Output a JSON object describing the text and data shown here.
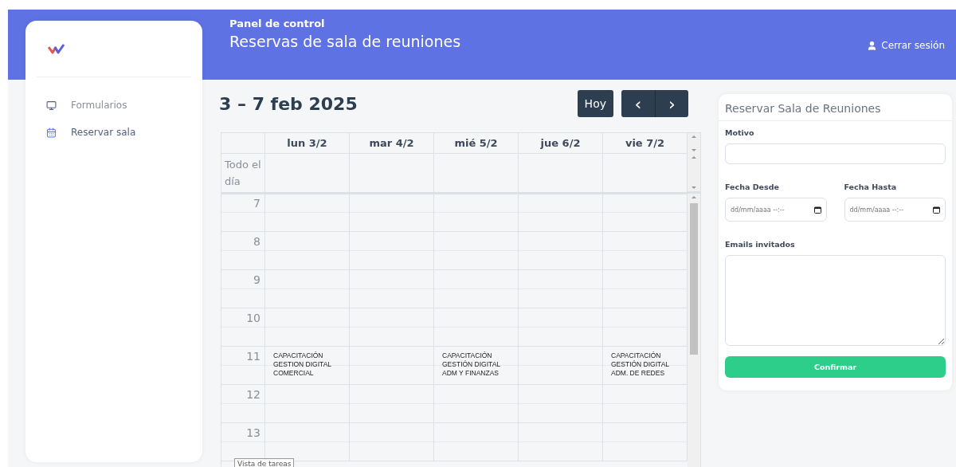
{
  "header": {
    "subtitle": "Panel de control",
    "title": "Reservas de sala de reuniones",
    "logout": "Cerrar sesión"
  },
  "sidebar": {
    "items": [
      {
        "label": "Formularios",
        "selected": false
      },
      {
        "label": "Reservar sala",
        "selected": true
      }
    ]
  },
  "calendar": {
    "range": "3 – 7 feb 2025",
    "today_button": "Hoy",
    "prev_button": "‹",
    "next_button": "›",
    "all_day_label": "Todo el día",
    "days": [
      "lun 3/2",
      "mar 4/2",
      "mié 5/2",
      "jue 6/2",
      "vie 7/2"
    ],
    "rows": [
      {
        "hour": "7"
      },
      {
        "hour": "8"
      },
      {
        "hour": "9"
      },
      {
        "hour": "10"
      },
      {
        "hour": "11",
        "cells": [
          "CAPACITACIÓN\nGESTION DIGITAL\nCOMERCIAL",
          null,
          "CAPACITACIÓN\nGESTIÓN DIGITAL\nADM Y FINANZAS",
          null,
          "CAPACITACIÓN\nGESTIÓN DIGITAL\nADM. DE REDES"
        ]
      },
      {
        "hour": "12"
      },
      {
        "hour": "13"
      }
    ],
    "tooltip": "Vista de tareas"
  },
  "form": {
    "title": "Reservar Sala de Reuniones",
    "motivo_label": "Motivo",
    "from_label": "Fecha Desde",
    "from_placeholder": "dd/mm/aaaa --:--",
    "to_label": "Fecha Hasta",
    "to_placeholder": "dd/mm/aaaa --:--",
    "emails_label": "Emails invitados",
    "submit": "Confirmar"
  }
}
